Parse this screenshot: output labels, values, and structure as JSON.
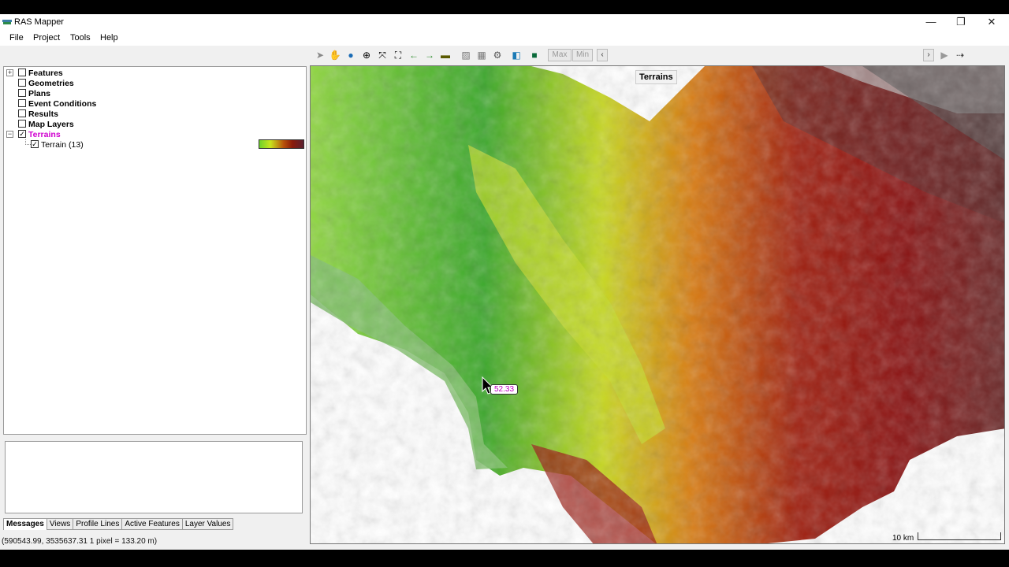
{
  "window": {
    "title": "RAS Mapper"
  },
  "window_controls": {
    "minimize": "—",
    "maximize": "❐",
    "close": "✕"
  },
  "menu": [
    "File",
    "Project",
    "Tools",
    "Help"
  ],
  "toolbar": {
    "max_label": "Max",
    "min_label": "Min"
  },
  "layers": [
    {
      "label": "Features",
      "checked": false,
      "bold": true,
      "expander": "+"
    },
    {
      "label": "Geometries",
      "checked": false,
      "bold": true
    },
    {
      "label": "Plans",
      "checked": false,
      "bold": true
    },
    {
      "label": "Event Conditions",
      "checked": false,
      "bold": true
    },
    {
      "label": "Results",
      "checked": false,
      "bold": true
    },
    {
      "label": "Map Layers",
      "checked": false,
      "bold": true
    },
    {
      "label": "Terrains",
      "checked": true,
      "bold": true,
      "expander": "−",
      "color": "#d000d0"
    }
  ],
  "terrain_child": {
    "label": "Terrain (13)",
    "checked": true
  },
  "bottom_tabs": [
    "Messages",
    "Views",
    "Profile Lines",
    "Active Features",
    "Layer Values"
  ],
  "status": {
    "coordinates": "(590543.99, 3535637.31  1 pixel = 133.20 m)"
  },
  "map": {
    "title": "Terrains",
    "cursor_value": "52.33",
    "scale_label": "10 km"
  },
  "colors": {
    "accent": "#d000d0",
    "terrain_low": "#6fd12a",
    "terrain_high": "#8a1a0a"
  }
}
